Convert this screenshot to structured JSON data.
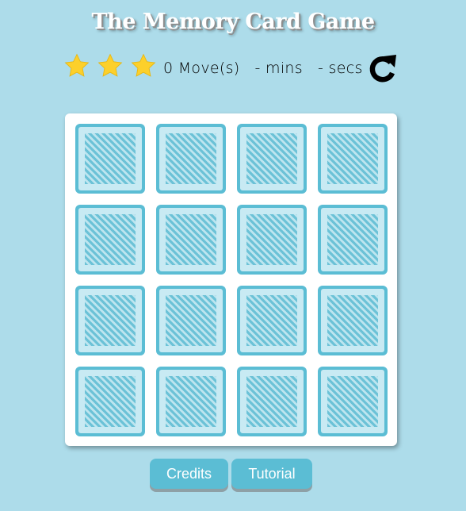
{
  "header": {
    "title": "The Memory Card Game"
  },
  "score_panel": {
    "stars": [
      {
        "icon": "star-icon",
        "filled": true
      },
      {
        "icon": "star-icon",
        "filled": true
      },
      {
        "icon": "star-icon",
        "filled": true
      }
    ],
    "moves_count": "0",
    "moves_label": "Move(s)",
    "minutes_value": "-",
    "minutes_label": "mins",
    "seconds_value": "-",
    "seconds_label": "secs",
    "restart_icon": "redo-icon"
  },
  "deck": {
    "rows": 4,
    "columns": 4,
    "cards": [
      {
        "state": "face-down"
      },
      {
        "state": "face-down"
      },
      {
        "state": "face-down"
      },
      {
        "state": "face-down"
      },
      {
        "state": "face-down"
      },
      {
        "state": "face-down"
      },
      {
        "state": "face-down"
      },
      {
        "state": "face-down"
      },
      {
        "state": "face-down"
      },
      {
        "state": "face-down"
      },
      {
        "state": "face-down"
      },
      {
        "state": "face-down"
      },
      {
        "state": "face-down"
      },
      {
        "state": "face-down"
      },
      {
        "state": "face-down"
      },
      {
        "state": "face-down"
      }
    ]
  },
  "footer": {
    "credits_label": "Credits",
    "tutorial_label": "Tutorial"
  },
  "colors": {
    "background": "#addcea",
    "card_back": "#5bbdd4",
    "star": "#fcd02b",
    "button": "#5bbdd4"
  }
}
